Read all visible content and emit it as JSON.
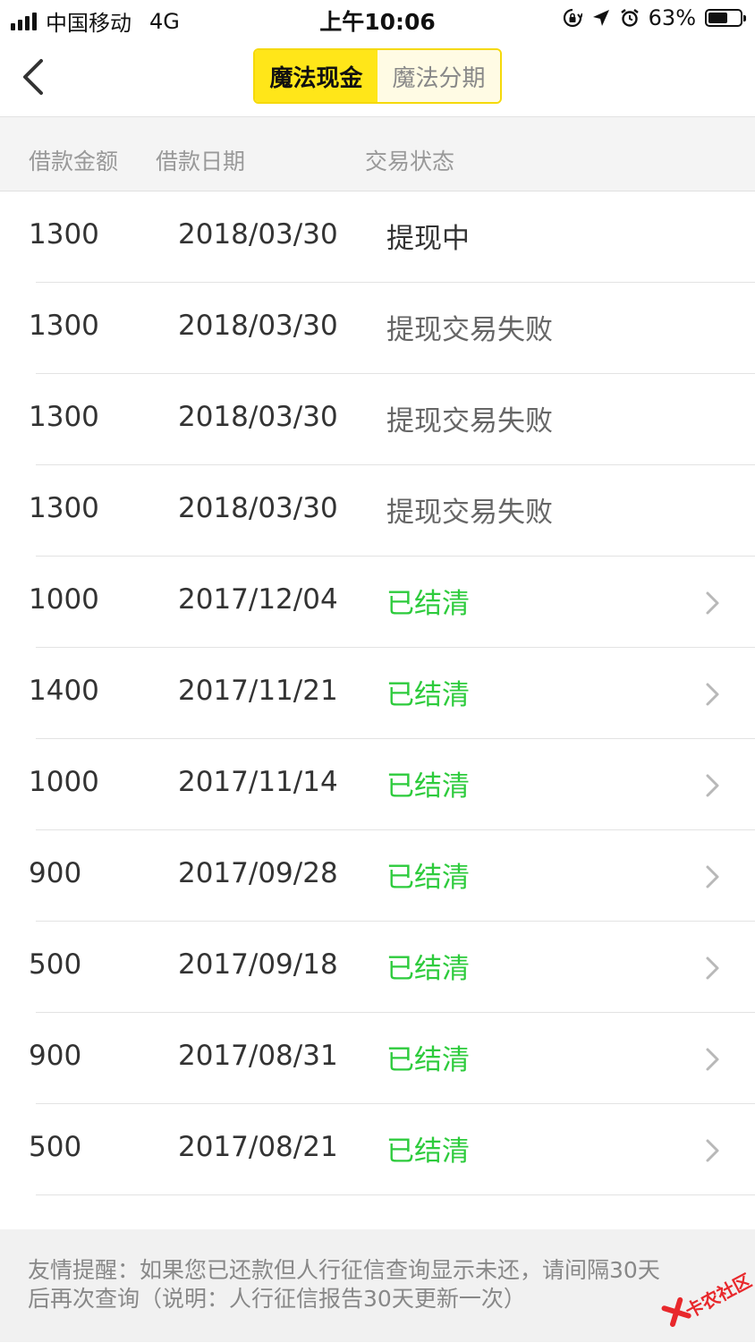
{
  "status_bar": {
    "carrier": "中国移动",
    "network": "4G",
    "time": "上午10:06",
    "battery_percent": "63%",
    "battery_level": 0.63
  },
  "nav": {
    "back_icon": "chevron-left-icon",
    "tabs": [
      {
        "label": "魔法现金",
        "active": true
      },
      {
        "label": "魔法分期",
        "active": false
      }
    ]
  },
  "table": {
    "headers": [
      "借款金额",
      "借款日期",
      "交易状态"
    ],
    "rows": [
      {
        "amount": "1300",
        "date": "2018/03/30",
        "status": "提现中",
        "state": "processing",
        "has_arrow": false
      },
      {
        "amount": "1300",
        "date": "2018/03/30",
        "status": "提现交易失败",
        "state": "failed",
        "has_arrow": false
      },
      {
        "amount": "1300",
        "date": "2018/03/30",
        "status": "提现交易失败",
        "state": "failed",
        "has_arrow": false
      },
      {
        "amount": "1300",
        "date": "2018/03/30",
        "status": "提现交易失败",
        "state": "failed",
        "has_arrow": false
      },
      {
        "amount": "1000",
        "date": "2017/12/04",
        "status": "已结清",
        "state": "settled",
        "has_arrow": true
      },
      {
        "amount": "1400",
        "date": "2017/11/21",
        "status": "已结清",
        "state": "settled",
        "has_arrow": true
      },
      {
        "amount": "1000",
        "date": "2017/11/14",
        "status": "已结清",
        "state": "settled",
        "has_arrow": true
      },
      {
        "amount": "900",
        "date": "2017/09/28",
        "status": "已结清",
        "state": "settled",
        "has_arrow": true
      },
      {
        "amount": "500",
        "date": "2017/09/18",
        "status": "已结清",
        "state": "settled",
        "has_arrow": true
      },
      {
        "amount": "900",
        "date": "2017/08/31",
        "status": "已结清",
        "state": "settled",
        "has_arrow": true
      },
      {
        "amount": "500",
        "date": "2017/08/21",
        "status": "已结清",
        "state": "settled",
        "has_arrow": true
      }
    ]
  },
  "notice": {
    "line1": "友情提醒：如果您已还款但人行征信查询显示未还，请间隔30天",
    "line2": "后再次查询（说明：人行征信报告30天更新一次）"
  },
  "watermark": {
    "text": "卡农社区"
  },
  "colors": {
    "accent_yellow": "#ffe619",
    "settled_green": "#2dcb3c",
    "header_gray": "#f4f4f4"
  }
}
